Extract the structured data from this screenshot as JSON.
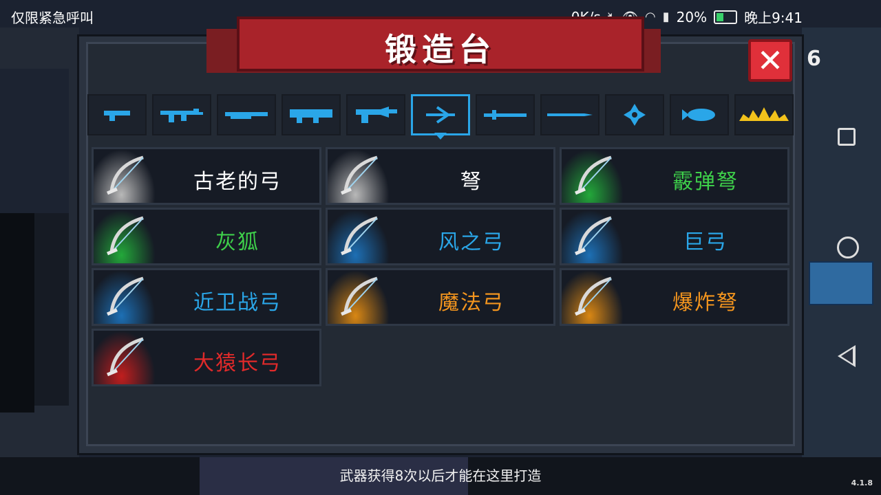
{
  "status_bar": {
    "carrier_text": "仅限紧急呼叫",
    "speed": "0K/s",
    "battery_pct": "20%",
    "time": "晚上9:41"
  },
  "title": "锻造台",
  "close_count": "6",
  "colors": {
    "panel": "#2b3340",
    "banner": "#a9232a",
    "tab_icon": "#2aa6e8",
    "rarity_white": "#ffffff",
    "rarity_green": "#3ecf4a",
    "rarity_blue": "#2aa6e8",
    "rarity_orange": "#f3951e",
    "rarity_red": "#e02a2a"
  },
  "tabs": [
    {
      "icon": "pistol-icon"
    },
    {
      "icon": "rifle-icon"
    },
    {
      "icon": "shotgun-icon"
    },
    {
      "icon": "launcher-icon"
    },
    {
      "icon": "energy-gun-icon"
    },
    {
      "icon": "bow-icon",
      "active": true
    },
    {
      "icon": "sword-icon"
    },
    {
      "icon": "spear-icon"
    },
    {
      "icon": "shuriken-icon"
    },
    {
      "icon": "fish-icon"
    },
    {
      "icon": "crown-icon"
    }
  ],
  "weapons": [
    {
      "name": "古老的弓",
      "rarity": "white",
      "icon": "ancient-bow-icon"
    },
    {
      "name": "弩",
      "rarity": "white",
      "icon": "crossbow-icon"
    },
    {
      "name": "霰弹弩",
      "rarity": "green",
      "icon": "shotgun-crossbow-icon"
    },
    {
      "name": "灰狐",
      "rarity": "green",
      "icon": "grey-fox-crossbow-icon"
    },
    {
      "name": "风之弓",
      "rarity": "blue",
      "icon": "wind-bow-icon"
    },
    {
      "name": "巨弓",
      "rarity": "blue",
      "icon": "giant-bow-icon"
    },
    {
      "name": "近卫战弓",
      "rarity": "blue",
      "icon": "guard-bow-icon"
    },
    {
      "name": "魔法弓",
      "rarity": "orange",
      "icon": "magic-bow-icon"
    },
    {
      "name": "爆炸弩",
      "rarity": "orange",
      "icon": "explosive-crossbow-icon"
    },
    {
      "name": "大猿长弓",
      "rarity": "red",
      "icon": "ape-longbow-icon"
    }
  ],
  "hint": "武器获得8次以后才能在这里打造",
  "version": "4.1.8"
}
